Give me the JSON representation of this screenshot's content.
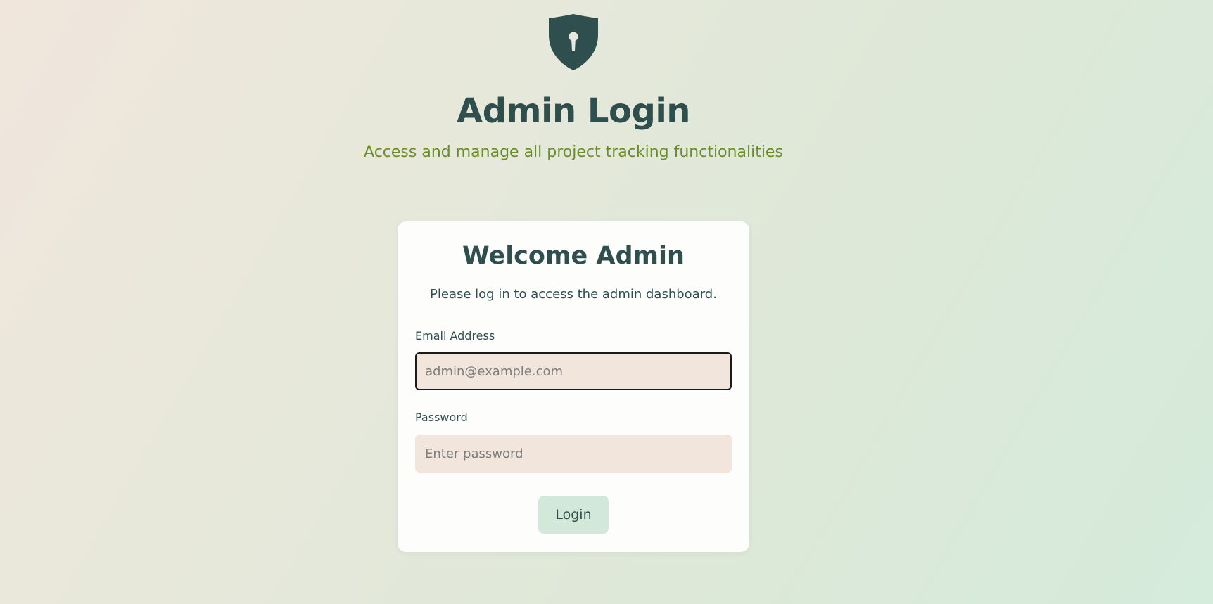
{
  "header": {
    "icon": "shield-keyhole-icon",
    "title": "Admin Login",
    "subtitle": "Access and manage all project tracking functionalities"
  },
  "card": {
    "title": "Welcome Admin",
    "description": "Please log in to access the admin dashboard.",
    "email": {
      "label": "Email Address",
      "placeholder": "admin@example.com",
      "value": ""
    },
    "password": {
      "label": "Password",
      "placeholder": "Enter password",
      "value": ""
    },
    "login_label": "Login"
  },
  "colors": {
    "primary": "#2f4f4f",
    "subtitle": "#6b8e23",
    "input_bg": "#f2e6dc",
    "button_bg": "#d2e8d9"
  }
}
